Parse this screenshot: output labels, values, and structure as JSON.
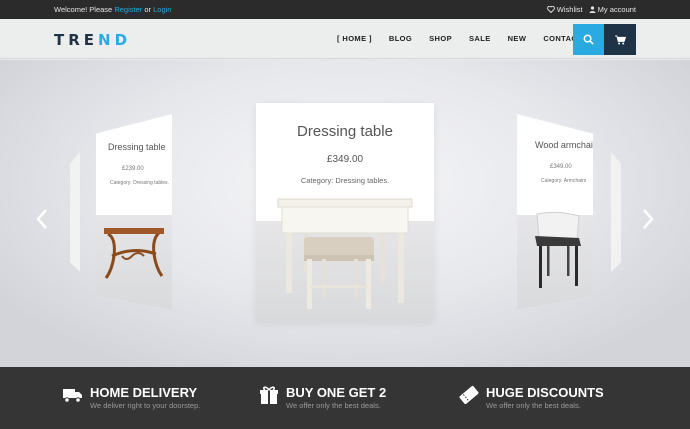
{
  "topbar": {
    "welcome_text": "Welcome! Please",
    "register_link": "Register",
    "or_text": "or",
    "login_link": "Login",
    "wishlist": "Wishlist",
    "account": "My account"
  },
  "brand": {
    "logo_dark": "TRE",
    "logo_accent": "ND",
    "accent_color": "#29aae1",
    "dark_color": "#1f3346"
  },
  "nav": {
    "items": [
      "[ HOME ]",
      "BLOG",
      "SHOP",
      "SALE",
      "NEW",
      "CONTACT"
    ]
  },
  "icons": {
    "search": "search-icon",
    "cart": "cart-icon",
    "prev": "chevron-left-icon",
    "next": "chevron-right-icon"
  },
  "slider": {
    "center": {
      "title": "Dressing table",
      "price": "£349.00",
      "category": "Category: Dressing tables."
    },
    "left": {
      "title": "Dressing table",
      "price": "£239.00",
      "category": "Category: Dressing tables."
    },
    "right": {
      "title": "Wood armchair",
      "price": "£349.00",
      "category": "Category: Armchairs"
    }
  },
  "features": [
    {
      "icon": "truck-icon",
      "title": "HOME DELIVERY",
      "subtitle": "We deliver right to your doorstep."
    },
    {
      "icon": "gift-icon",
      "title": "BUY ONE GET 2",
      "subtitle": "We offer only the best deals."
    },
    {
      "icon": "ticket-icon",
      "title": "HUGE DISCOUNTS",
      "subtitle": "We offer only the best deals."
    }
  ]
}
